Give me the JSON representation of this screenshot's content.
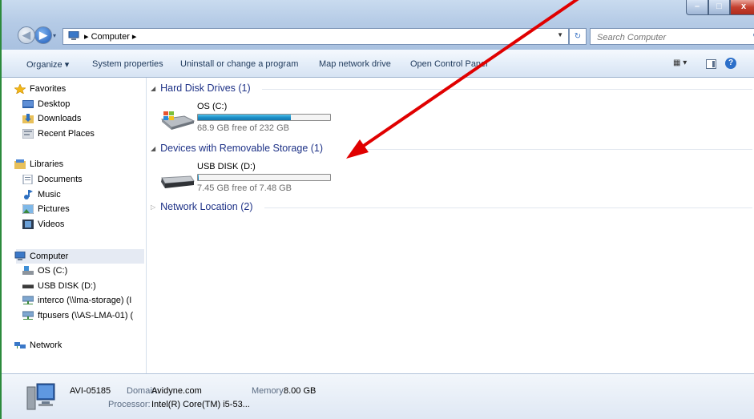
{
  "window": {
    "controls": {
      "minimize": "–",
      "maximize": "□",
      "close": "x"
    }
  },
  "address": {
    "path": "▸ Computer ▸",
    "dropdown_icon": "chevron-down-icon",
    "search_placeholder": "Search Computer"
  },
  "toolbar": {
    "organize": "Organize ▾",
    "system_properties": "System properties",
    "uninstall": "Uninstall or change a program",
    "map_drive": "Map network drive",
    "control_panel": "Open Control Panel",
    "help": "?"
  },
  "sidebar": {
    "favorites": {
      "label": "Favorites",
      "items": [
        "Desktop",
        "Downloads",
        "Recent Places"
      ]
    },
    "libraries": {
      "label": "Libraries",
      "items": [
        "Documents",
        "Music",
        "Pictures",
        "Videos"
      ]
    },
    "computer": {
      "label": "Computer",
      "items": [
        "OS (C:)",
        "USB DISK (D:)",
        "interco (\\\\lma-storage) (I",
        "ftpusers (\\\\AS-LMA-01) ("
      ]
    },
    "network": {
      "label": "Network"
    }
  },
  "groups": {
    "hard_disks": {
      "header": "Hard Disk Drives (1)",
      "drives": [
        {
          "name": "OS (C:)",
          "free_text": "68.9 GB free of 232 GB",
          "used_fraction": 0.703
        }
      ]
    },
    "removable": {
      "header": "Devices with Removable Storage (1)",
      "drives": [
        {
          "name": "USB DISK (D:)",
          "free_text": "7.45 GB free of 7.48 GB",
          "used_fraction": 0.004
        }
      ]
    },
    "network": {
      "header": "Network Location (2)"
    }
  },
  "details": {
    "computer_name": "AVI-05185",
    "domain_label": "Domain:",
    "domain_value": "Avidyne.com",
    "memory_label": "Memory:",
    "memory_value": "8.00 GB",
    "processor_label": "Processor:",
    "processor_value": "Intel(R) Core(TM) i5-53..."
  },
  "colors": {
    "annotation_arrow": "#e00000",
    "link_blue": "#1e3287",
    "usage_bar": "#1e90c7"
  }
}
